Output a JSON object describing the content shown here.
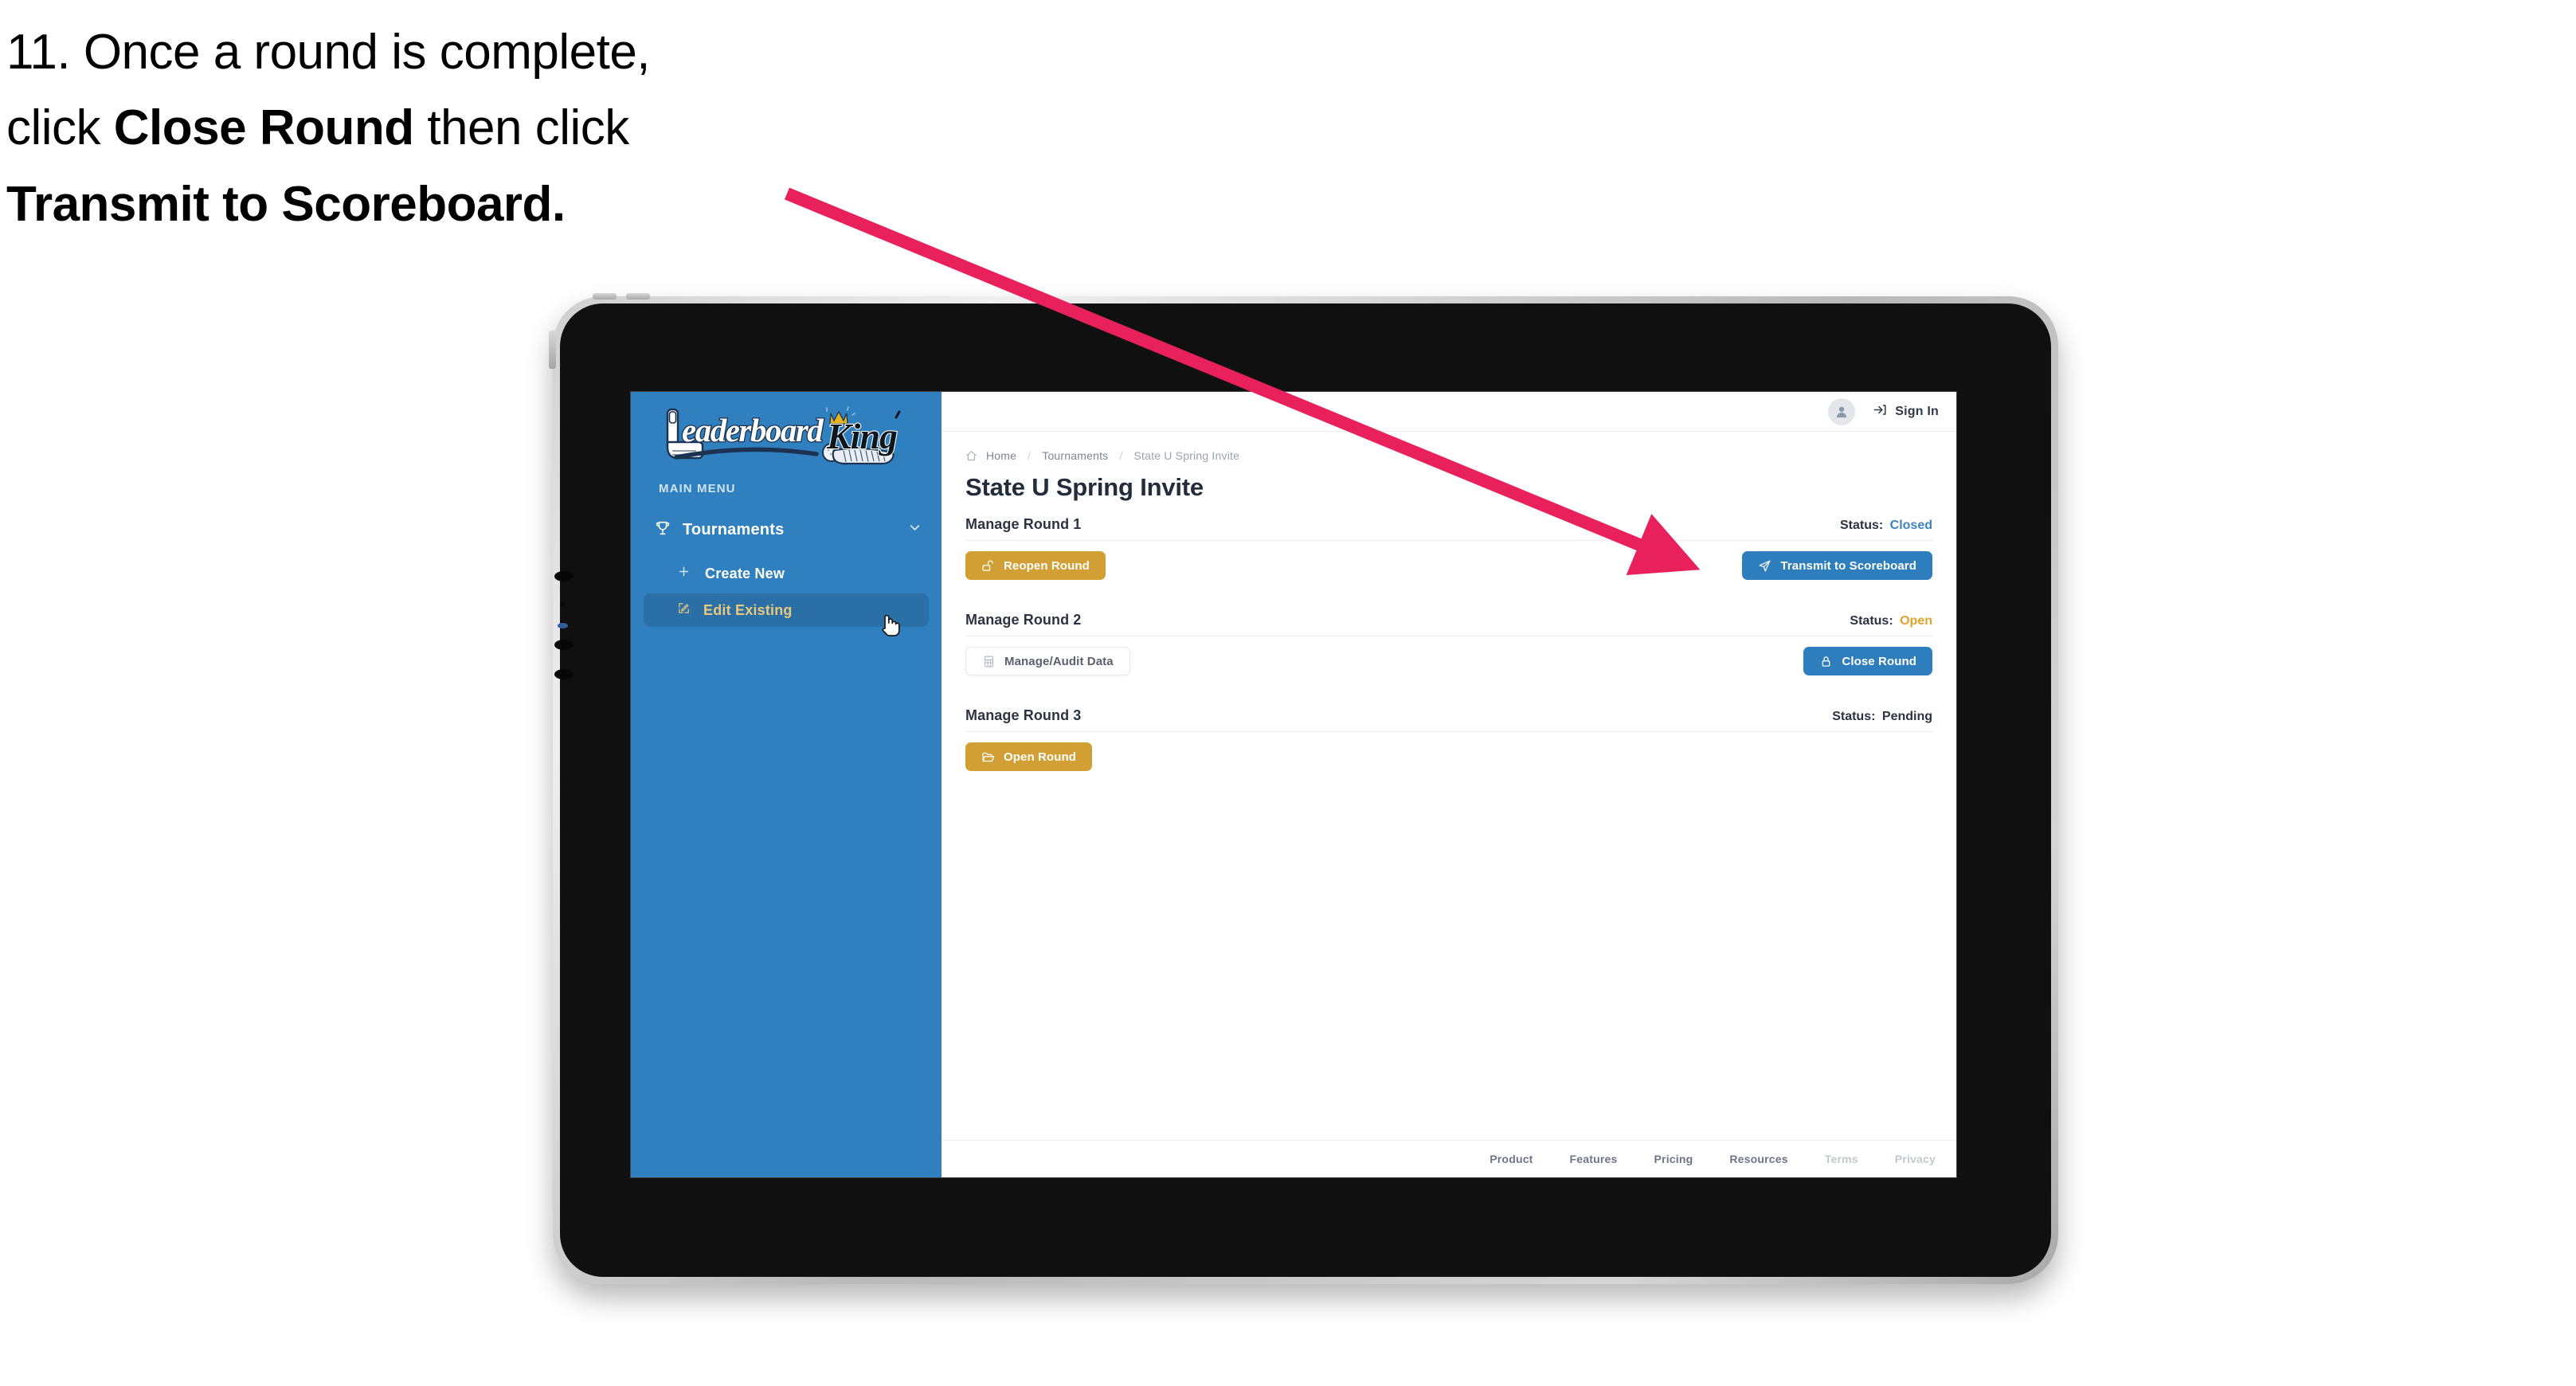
{
  "caption": {
    "line1_prefix": "11. Once a round is complete,",
    "line2_prefix": "click ",
    "line2_bold": "Close Round",
    "line2_suffix": " then click",
    "line3_bold": "Transmit to Scoreboard."
  },
  "colors": {
    "sidebar_blue": "#3080bf",
    "accent_gold": "#d19f33",
    "accent_blue": "#2e7ebe",
    "annotation_pink": "#e8215c",
    "status_closed": "#3b82c4",
    "status_open": "#e0a22b"
  },
  "sidebar": {
    "logo_primary": "Leaderboard",
    "logo_secondary": "King",
    "section_label": "MAIN MENU",
    "items": [
      {
        "label": "Tournaments",
        "icon": "trophy-icon",
        "expand_icon": "chevron-down-icon",
        "active": false
      },
      {
        "label": "Create New",
        "icon": "plus-icon",
        "active": false
      },
      {
        "label": "Edit Existing",
        "icon": "edit-pencil-icon",
        "active": true
      }
    ]
  },
  "topbar": {
    "avatar_icon": "user-avatar-icon",
    "signin_icon": "sign-in-arrow-icon",
    "signin_label": "Sign In"
  },
  "breadcrumb": {
    "home_icon": "home-icon",
    "items": [
      "Home",
      "Tournaments",
      "State U Spring Invite"
    ],
    "separator": "/"
  },
  "page": {
    "title": "State U Spring Invite"
  },
  "rounds": [
    {
      "title": "Manage Round 1",
      "status_label": "Status:",
      "status_value": "Closed",
      "status_class": "status-closed",
      "left_button": {
        "label": "Reopen Round",
        "style": "btn-gold",
        "icon": "unlock-icon"
      },
      "right_button": {
        "label": "Transmit to Scoreboard",
        "style": "btn-blue",
        "icon": "paper-plane-icon"
      }
    },
    {
      "title": "Manage Round 2",
      "status_label": "Status:",
      "status_value": "Open",
      "status_class": "status-open",
      "left_button": {
        "label": "Manage/Audit Data",
        "style": "btn-ghost",
        "icon": "table-grid-icon"
      },
      "right_button": {
        "label": "Close Round",
        "style": "btn-blue",
        "icon": "lock-icon"
      }
    },
    {
      "title": "Manage Round 3",
      "status_label": "Status:",
      "status_value": "Pending",
      "status_class": "status-pending",
      "left_button": {
        "label": "Open Round",
        "style": "btn-gold",
        "icon": "folder-open-icon"
      },
      "right_button": null
    }
  ],
  "footer": {
    "links": [
      {
        "label": "Product",
        "muted": false
      },
      {
        "label": "Features",
        "muted": false
      },
      {
        "label": "Pricing",
        "muted": false
      },
      {
        "label": "Resources",
        "muted": false
      },
      {
        "label": "Terms",
        "muted": true
      },
      {
        "label": "Privacy",
        "muted": true
      }
    ]
  },
  "cursor": {
    "icon": "hand-pointer-cursor"
  },
  "annotation": {
    "icon": "arrow-annotation"
  }
}
